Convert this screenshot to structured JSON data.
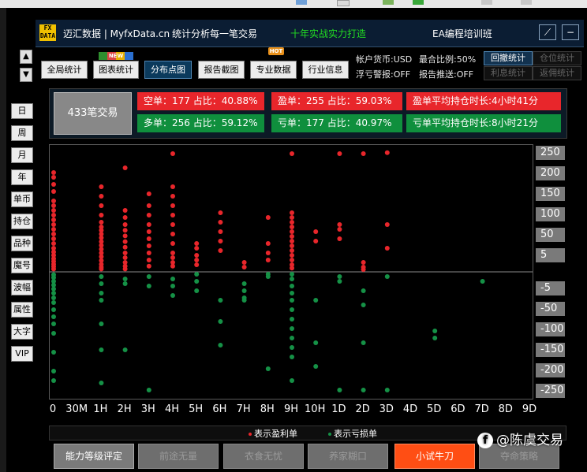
{
  "titlebar": {
    "logo": "FX DATA",
    "site": "迈汇数据 | MyfxData.cn",
    "slogan": "统计分析每一笔交易",
    "promo": "十年实战实力打造",
    "course": "EA编程培训班",
    "edit_icon": "⟋",
    "minimize_icon": "−"
  },
  "nav": {
    "up_arrow": "▲",
    "down_arrow": "▼",
    "tabs": [
      "全局统计",
      "图表统计",
      "分布点图",
      "报告截图",
      "专业数据",
      "行业信息"
    ],
    "active_index": 2,
    "new_badge": "NEW",
    "hot_badge": "HOT"
  },
  "account": {
    "currency": "帐户货币:USD",
    "drawdown_ratio": "最合比例:50%",
    "float_alert": "浮亏警报:OFF",
    "report_push": "报告推送:OFF",
    "buttons": [
      {
        "label": "回撤统计",
        "state": "on"
      },
      {
        "label": "仓位统计",
        "state": "off"
      },
      {
        "label": "利息统计",
        "state": "off"
      },
      {
        "label": "返佣统计",
        "state": "off"
      }
    ]
  },
  "sidebar": {
    "items": [
      "日",
      "周",
      "月",
      "年",
      "单币",
      "持仓",
      "品种",
      "魔号",
      "波幅",
      "属性",
      "大字",
      "VIP"
    ]
  },
  "summary": {
    "total": "433笔交易",
    "short": "空单：177  占比：40.88%",
    "long": "多单：256  占比：59.12%",
    "profit": "盈单：255  占比：59.03%",
    "loss": "亏单：177  占比：40.97%",
    "avg_profit_hold": "盈单平均持仓时长:4小时41分",
    "avg_loss_hold": "亏单平均持仓时长:8小时21分"
  },
  "chart_data": {
    "type": "scatter",
    "x_categories": [
      "0",
      "30M",
      "1H",
      "2H",
      "3H",
      "4H",
      "5H",
      "6H",
      "7H",
      "8H",
      "9H",
      "10H",
      "1D",
      "2D",
      "3D",
      "4D",
      "5D",
      "6D",
      "7D",
      "8D",
      "9D"
    ],
    "y_tick_labels": [
      "250",
      "200",
      "150",
      "100",
      "50",
      "5",
      "-5",
      "-50",
      "-100",
      "-150",
      "-200",
      "-250"
    ],
    "legend": [
      "表示盈利单",
      "表示亏损单"
    ],
    "colors": {
      "profit": "#e8262b",
      "loss": "#159146"
    },
    "series": [
      {
        "name": "表示盈利单",
        "points": [
          [
            0,
            210
          ],
          [
            0,
            200
          ],
          [
            0,
            185
          ],
          [
            0,
            170
          ],
          [
            0,
            150
          ],
          [
            0,
            140
          ],
          [
            0,
            130
          ],
          [
            0,
            120
          ],
          [
            0,
            110
          ],
          [
            0,
            100
          ],
          [
            0,
            90
          ],
          [
            0,
            80
          ],
          [
            0,
            70
          ],
          [
            0,
            60
          ],
          [
            0,
            50
          ],
          [
            0,
            42
          ],
          [
            0,
            35
          ],
          [
            0,
            28
          ],
          [
            0,
            22
          ],
          [
            0,
            16
          ],
          [
            0,
            11
          ],
          [
            0,
            6
          ],
          [
            2,
            180
          ],
          [
            2,
            160
          ],
          [
            2,
            140
          ],
          [
            2,
            120
          ],
          [
            2,
            105
          ],
          [
            2,
            95
          ],
          [
            2,
            88
          ],
          [
            2,
            80
          ],
          [
            2,
            72
          ],
          [
            2,
            64
          ],
          [
            2,
            56
          ],
          [
            2,
            48
          ],
          [
            2,
            40
          ],
          [
            2,
            32
          ],
          [
            2,
            24
          ],
          [
            2,
            16
          ],
          [
            2,
            10
          ],
          [
            2,
            6
          ],
          [
            3,
            220
          ],
          [
            3,
            130
          ],
          [
            3,
            115
          ],
          [
            3,
            100
          ],
          [
            3,
            88
          ],
          [
            3,
            76
          ],
          [
            3,
            64
          ],
          [
            3,
            52
          ],
          [
            3,
            40
          ],
          [
            3,
            30
          ],
          [
            3,
            20
          ],
          [
            3,
            12
          ],
          [
            3,
            6
          ],
          [
            4,
            165
          ],
          [
            4,
            140
          ],
          [
            4,
            120
          ],
          [
            4,
            100
          ],
          [
            4,
            85
          ],
          [
            4,
            70
          ],
          [
            4,
            55
          ],
          [
            4,
            40
          ],
          [
            4,
            25
          ],
          [
            4,
            12
          ],
          [
            5,
            250
          ],
          [
            5,
            180
          ],
          [
            5,
            160
          ],
          [
            5,
            140
          ],
          [
            5,
            120
          ],
          [
            5,
            100
          ],
          [
            5,
            80
          ],
          [
            5,
            60
          ],
          [
            5,
            40
          ],
          [
            5,
            30
          ],
          [
            5,
            20
          ],
          [
            5,
            12
          ],
          [
            6,
            60
          ],
          [
            6,
            50
          ],
          [
            6,
            35
          ],
          [
            6,
            25
          ],
          [
            6,
            15
          ],
          [
            7,
            125
          ],
          [
            7,
            105
          ],
          [
            7,
            85
          ],
          [
            7,
            65
          ],
          [
            7,
            45
          ],
          [
            8,
            20
          ],
          [
            8,
            10
          ],
          [
            9,
            115
          ],
          [
            9,
            60
          ],
          [
            9,
            40
          ],
          [
            9,
            25
          ],
          [
            10,
            250
          ],
          [
            10,
            125
          ],
          [
            10,
            115
          ],
          [
            10,
            105
          ],
          [
            10,
            95
          ],
          [
            10,
            85
          ],
          [
            10,
            75
          ],
          [
            10,
            65
          ],
          [
            10,
            55
          ],
          [
            10,
            45
          ],
          [
            10,
            35
          ],
          [
            10,
            25
          ],
          [
            10,
            15
          ],
          [
            10,
            8
          ],
          [
            11,
            85
          ],
          [
            11,
            65
          ],
          [
            12,
            250
          ],
          [
            12,
            100
          ],
          [
            12,
            90
          ],
          [
            12,
            70
          ],
          [
            13,
            250
          ],
          [
            13,
            20
          ],
          [
            13,
            10
          ],
          [
            13,
            5
          ],
          [
            14,
            100
          ],
          [
            14,
            50
          ],
          [
            14,
            252
          ]
        ]
      },
      {
        "name": "表示亏损单",
        "points": [
          [
            0,
            -6
          ],
          [
            0,
            -12
          ],
          [
            0,
            -20
          ],
          [
            0,
            -28
          ],
          [
            0,
            -36
          ],
          [
            0,
            -45
          ],
          [
            0,
            -55
          ],
          [
            0,
            -65
          ],
          [
            0,
            -80
          ],
          [
            0,
            -95
          ],
          [
            0,
            -110
          ],
          [
            0,
            -130
          ],
          [
            0,
            -170
          ],
          [
            0,
            -210
          ],
          [
            0,
            -230
          ],
          [
            2,
            -10
          ],
          [
            2,
            -25
          ],
          [
            2,
            -45
          ],
          [
            2,
            -60
          ],
          [
            2,
            -110
          ],
          [
            2,
            -165
          ],
          [
            2,
            -235
          ],
          [
            3,
            -15
          ],
          [
            3,
            -25
          ],
          [
            3,
            -165
          ],
          [
            4,
            -10
          ],
          [
            4,
            -30
          ],
          [
            4,
            -250
          ],
          [
            5,
            -15
          ],
          [
            5,
            -30
          ],
          [
            5,
            -50
          ],
          [
            6,
            -5
          ],
          [
            6,
            -20
          ],
          [
            6,
            -40
          ],
          [
            7,
            -60
          ],
          [
            7,
            -105
          ],
          [
            7,
            -155
          ],
          [
            8,
            -25
          ],
          [
            8,
            -40
          ],
          [
            8,
            -55
          ],
          [
            8,
            -60
          ],
          [
            9,
            -5
          ],
          [
            9,
            -10
          ],
          [
            9,
            -205
          ],
          [
            10,
            -5
          ],
          [
            10,
            -15
          ],
          [
            10,
            -30
          ],
          [
            10,
            -45
          ],
          [
            10,
            -60
          ],
          [
            10,
            -80
          ],
          [
            10,
            -100
          ],
          [
            10,
            -120
          ],
          [
            10,
            -140
          ],
          [
            10,
            -160
          ],
          [
            10,
            -180
          ],
          [
            10,
            -230
          ],
          [
            11,
            -60
          ],
          [
            11,
            -150
          ],
          [
            11,
            -200
          ],
          [
            12,
            -10
          ],
          [
            12,
            -20
          ],
          [
            12,
            -250
          ],
          [
            13,
            -40
          ],
          [
            13,
            -70
          ],
          [
            13,
            -150
          ],
          [
            13,
            -250
          ],
          [
            14,
            -10
          ],
          [
            14,
            -250
          ],
          [
            16,
            -125
          ],
          [
            16,
            -140
          ],
          [
            18,
            -20
          ]
        ]
      }
    ]
  },
  "ability": {
    "buttons": [
      {
        "label": "能力等级评定",
        "style": "normal"
      },
      {
        "label": "前途无量",
        "style": "dim"
      },
      {
        "label": "衣食无忧",
        "style": "dim"
      },
      {
        "label": "养家糊口",
        "style": "dim"
      },
      {
        "label": "小试牛刀",
        "style": "hot"
      },
      {
        "label": "夺命策略",
        "style": "dim"
      }
    ]
  },
  "watermark": {
    "icon": "f",
    "text": "@陈虞交易"
  }
}
